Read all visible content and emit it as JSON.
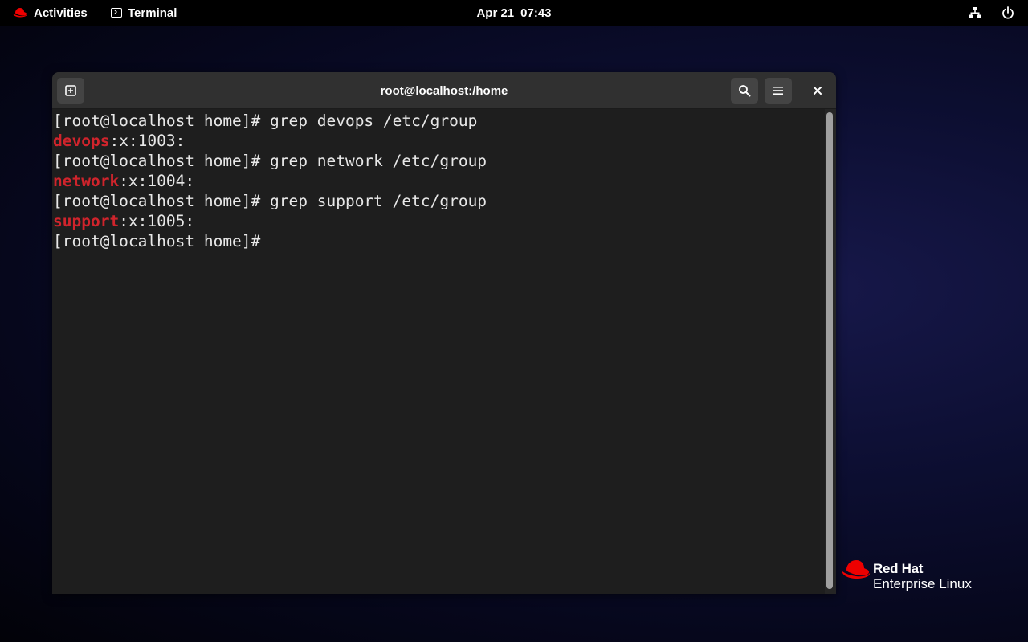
{
  "topbar": {
    "activities_label": "Activities",
    "app_name": "Terminal",
    "date": "Apr 21",
    "time": "07:43"
  },
  "window": {
    "title": "root@localhost:/home",
    "lines": [
      {
        "prompt": "[root@localhost home]# ",
        "command": "grep devops /etc/group"
      },
      {
        "match": "devops",
        "rest": ":x:1003:"
      },
      {
        "prompt": "[root@localhost home]# ",
        "command": "grep network /etc/group"
      },
      {
        "match": "network",
        "rest": ":x:1004:"
      },
      {
        "prompt": "[root@localhost home]# ",
        "command": "grep support /etc/group"
      },
      {
        "match": "support",
        "rest": ":x:1005:"
      },
      {
        "prompt": "[root@localhost home]# ",
        "command": ""
      }
    ]
  },
  "brand": {
    "line1": "Red Hat",
    "line2": "Enterprise Linux"
  },
  "icons": {
    "activities": "redhat-logo-icon",
    "app": "terminal-icon",
    "network": "network-icon",
    "power": "power-icon",
    "new_tab": "new-tab-icon",
    "search": "search-icon",
    "menu": "hamburger-menu-icon",
    "close": "close-icon"
  },
  "colors": {
    "grep_match": "#d0242c",
    "redhat_red": "#ee0000",
    "terminal_bg": "#1e1e1e",
    "headerbar_bg": "#303030"
  }
}
